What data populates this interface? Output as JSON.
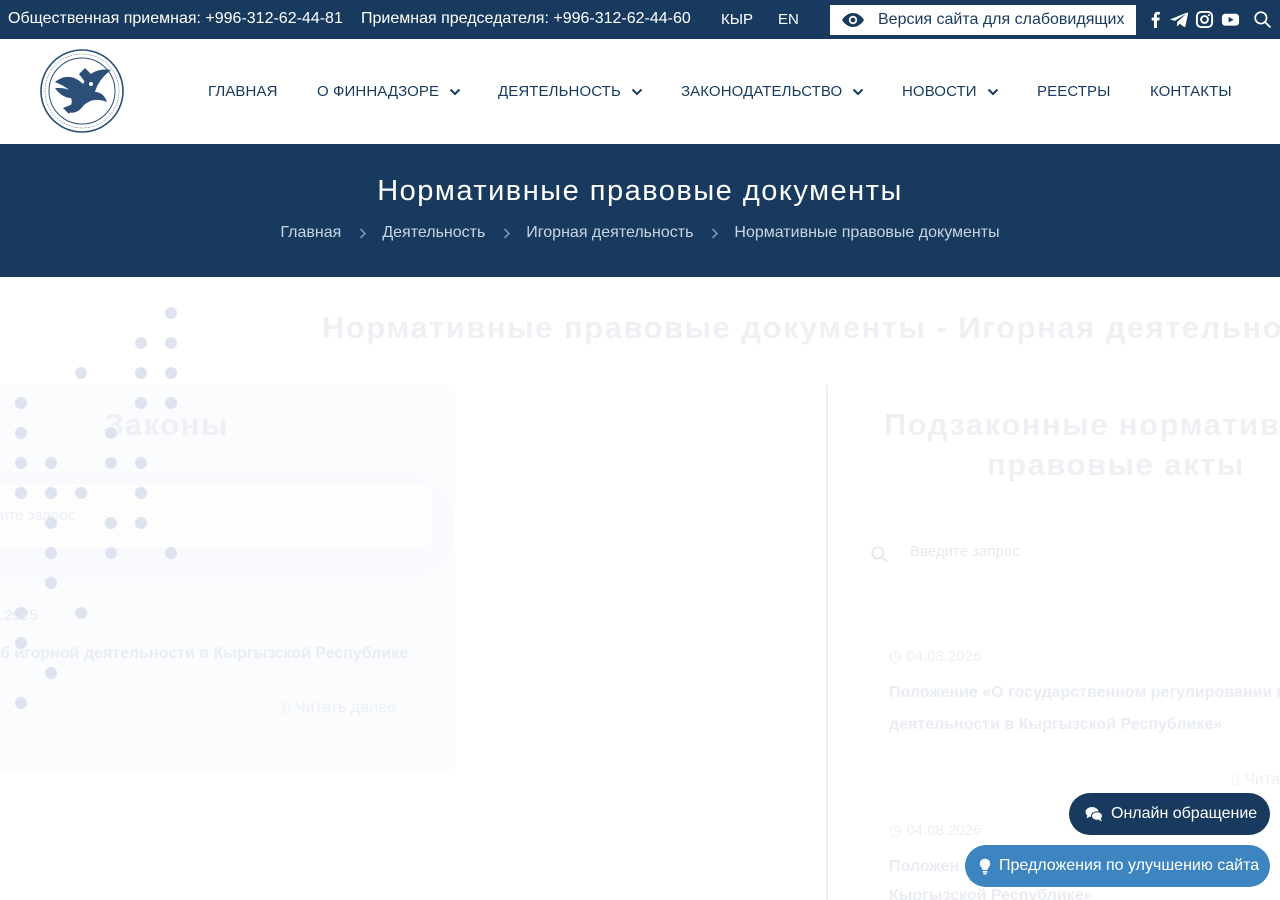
{
  "topbar": {
    "public_reception": "Общественная приемная: +996-312-62-44-81",
    "chairman_reception": "Приемная председателя: +996-312-62-44-60",
    "lang_kg": "КЫР",
    "lang_en": "EN",
    "low_vision_label": "Версия сайта для слабовидящих",
    "social": [
      "facebook-icon",
      "telegram-icon",
      "instagram-icon",
      "youtube-icon"
    ]
  },
  "nav": {
    "items": [
      {
        "label": "ГЛАВНАЯ",
        "dropdown": false
      },
      {
        "label": "О ФИННАДЗОРЕ",
        "dropdown": true
      },
      {
        "label": "ДЕЯТЕЛЬНОСТЬ",
        "dropdown": true
      },
      {
        "label": "ЗАКОНОДАТЕЛЬСТВО",
        "dropdown": true
      },
      {
        "label": "НОВОСТИ",
        "dropdown": true
      },
      {
        "label": "РЕЕСТРЫ",
        "dropdown": false
      },
      {
        "label": "КОНТАКТЫ",
        "dropdown": false
      }
    ]
  },
  "hero": {
    "title": "Нормативные правовые документы",
    "breadcrumbs": [
      "Главная",
      "Деятельность",
      "Игорная деятельность",
      "Нормативные правовые документы"
    ]
  },
  "content": {
    "subtitle": "Нормативные правовые документы - Игорная деятельнос",
    "left_title": "Законы",
    "left_search_fragment": "ите запрос",
    "left_date_fragment": ".2025",
    "left_doc_title": "б игорной деятельности в Кыргызской Республике",
    "left_read_more": "Читать далее",
    "right_title_line1": "Подзаконные норматив",
    "right_title_line2": "правовые акты",
    "right_search_placeholder": "Введите запрос",
    "right_date_1": "04.08.2026",
    "right_doc_1_line1": "Положение «О государственном регулировании и",
    "right_doc_1_line2": "деятельности в Кыргызской Республике»",
    "right_read_more": "Чита",
    "right_date_2": "04.08.2026",
    "right_doc_2_line1": "Положен",
    "right_doc_2_line2": "Кыргызской Республике»"
  },
  "floating": {
    "online_label": "Онлайн обращение",
    "suggest_label": "Предложения по улучшению сайта"
  },
  "colors": {
    "brand_navy": "#183a5e",
    "suggest_blue": "#3d85c0",
    "dot_color": "#dfe3ef"
  }
}
